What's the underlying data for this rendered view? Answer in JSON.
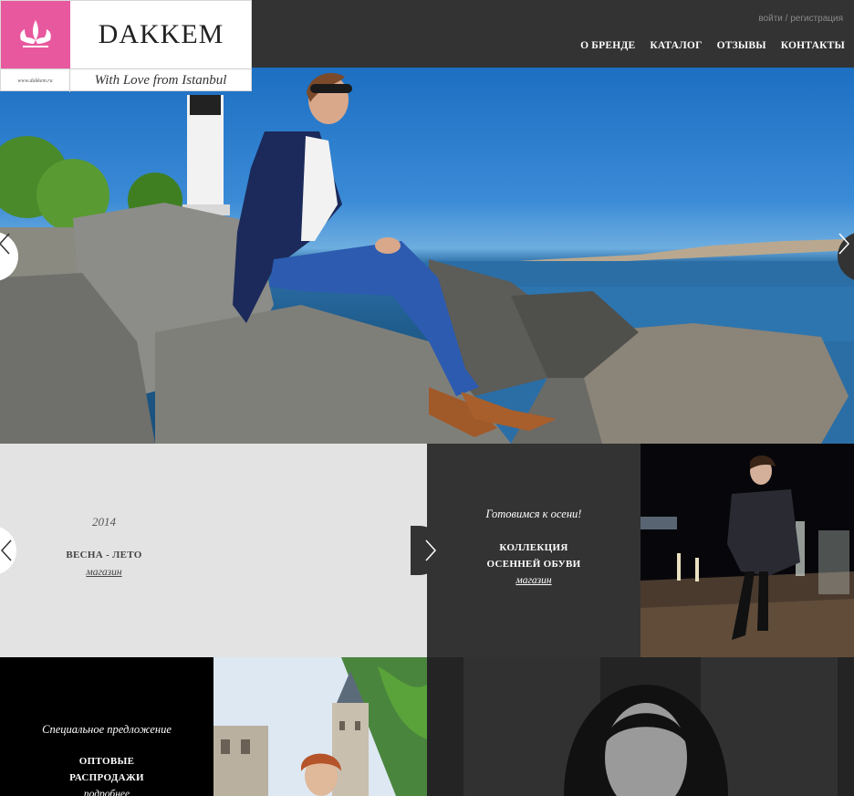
{
  "brand": {
    "name": "DAKKEM",
    "url_text": "www.dakkem.ru",
    "tagline": "With Love from Istanbul",
    "accent_color": "#e8589e"
  },
  "auth": {
    "login": "войти",
    "separator": "/",
    "register": "регистрация"
  },
  "nav": {
    "items": [
      "О БРЕНДЕ",
      "КАТАЛОГ",
      "ОТЗЫВЫ",
      "КОНТАКТЫ"
    ]
  },
  "hero": {
    "prev_icon": "chevron-left-icon",
    "next_icon": "chevron-right-icon"
  },
  "promos": {
    "spring": {
      "year": "2014",
      "title": "ВЕСНА - ЛЕТО",
      "link": "магазин"
    },
    "autumn": {
      "subtitle": "Готовимся к осени!",
      "title_line1": "КОЛЛЕКЦИЯ",
      "title_line2": "ОСЕННЕЙ ОБУВИ",
      "link": "магазин"
    },
    "special": {
      "subtitle": "Специальное предложение",
      "title_line1": "ОПТОВЫЕ",
      "title_line2": "РАСПРОДАЖИ",
      "link": "подробнее"
    }
  }
}
